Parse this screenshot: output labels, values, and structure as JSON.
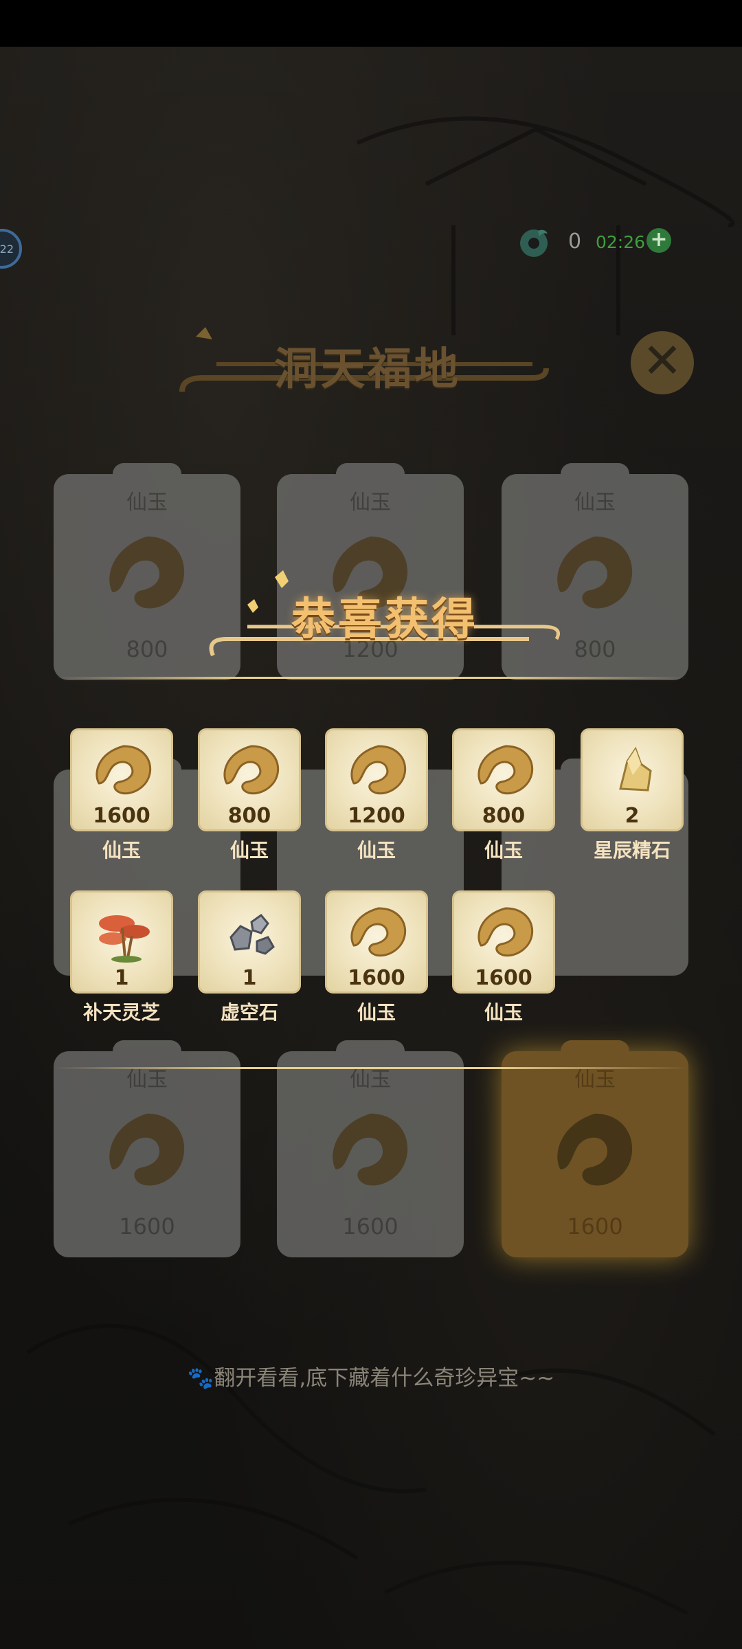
{
  "hud": {
    "level": "22",
    "jade_count": "0",
    "timer": "02:26",
    "plus": "+"
  },
  "dim_banner": {
    "title": "洞天福地",
    "close": "✕"
  },
  "background_cards": [
    {
      "label": "仙玉",
      "count": "800"
    },
    {
      "label": "仙玉",
      "count": "1200"
    },
    {
      "label": "仙玉",
      "count": "800"
    },
    {
      "label": "仙玉",
      "count": "1600"
    },
    {
      "label": "仙玉",
      "count": "1600"
    },
    {
      "label": "仙玉",
      "count": "1600"
    }
  ],
  "congrats": {
    "title": "恭喜获得"
  },
  "rewards": [
    {
      "qty": "1600",
      "name": "仙玉",
      "icon": "jade-icon"
    },
    {
      "qty": "800",
      "name": "仙玉",
      "icon": "jade-icon"
    },
    {
      "qty": "1200",
      "name": "仙玉",
      "icon": "jade-icon"
    },
    {
      "qty": "800",
      "name": "仙玉",
      "icon": "jade-icon"
    },
    {
      "qty": "2",
      "name": "星辰精石",
      "icon": "star-crystal-icon"
    },
    {
      "qty": "1",
      "name": "补天灵芝",
      "icon": "lingzhi-icon"
    },
    {
      "qty": "1",
      "name": "虚空石",
      "icon": "void-stone-icon"
    },
    {
      "qty": "1600",
      "name": "仙玉",
      "icon": "jade-icon"
    },
    {
      "qty": "1600",
      "name": "仙玉",
      "icon": "jade-icon"
    }
  ],
  "hint": "🐾翻开看看,底下藏着什么奇珍异宝~~",
  "colors": {
    "gold": "#f2c070",
    "timer_green": "#3f9e3f",
    "tile_bg": "#efe3bd"
  }
}
